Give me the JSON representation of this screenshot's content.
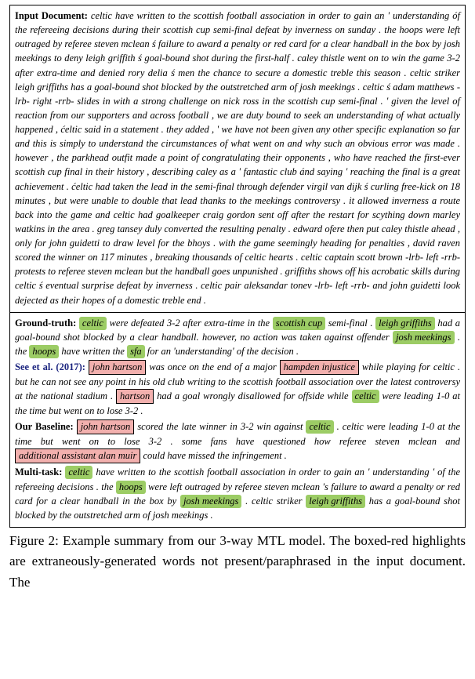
{
  "input": {
    "label": "Input Document:",
    "text": "celtic have written to the scottish football association in order to gain an ' understanding óf the refereeing decisions during their scottish cup semi-final defeat by inverness on sunday . the hoops were left outraged by referee steven mclean ś failure to award a penalty or red card for a clear handball in the box by josh meekings to deny leigh griffith ś goal-bound shot during the first-half . caley thistle went on to win the game 3-2 after extra-time and denied rory delia ś men the chance to secure a domestic treble this season . celtic striker leigh griffiths has a goal-bound shot blocked by the outstretched arm of josh meekings . celtic ś adam matthews -lrb- right -rrb- slides in with a strong challenge on nick ross in the scottish cup semi-final . ' given the level of reaction from our supporters and across football , we are duty bound to seek an understanding of what actually happened , ćeltic said in a statement .  they added , ' we have not been given any other specific explanation so far and this is simply to understand the circumstances of what went on and why such an obvious error was made . however , the parkhead outfit made a point of congratulating their opponents , who have reached the first-ever scottish cup final in their history , describing caley as a ' fantastic club ánd saying ' reaching the final is a great achievement . ćeltic had taken the lead in the semi-final through defender virgil van dijk ś curling free-kick on 18 minutes , but were unable to double that lead thanks to the meekings controversy .  it allowed inverness a route back into the game and celtic had goalkeeper craig gordon sent off after the restart for scything down marley watkins in the area . greg tansey duly converted the resulting penalty . edward ofere then put caley thistle ahead , only for john guidetti to draw level for the bhoys .  with the game seemingly heading for penalties , david raven scored the winner on 117 minutes , breaking thousands of celtic hearts . celtic captain scott brown -lrb- left -rrb- protests to referee steven mclean but the handball goes unpunished . griffiths shows off his acrobatic skills during celtic ś eventual surprise defeat by inverness . celtic pair aleksandar tonev -lrb- left -rrb- and john guidetti look dejected as their hopes of a domestic treble end ."
  },
  "ground_truth": {
    "label": "Ground-truth:",
    "hl": {
      "celtic": "celtic",
      "scottish_cup": "scottish cup",
      "leigh_griffiths": "leigh griffiths",
      "josh_meekings": "josh meekings",
      "hoops": "hoops",
      "sfa": "sfa"
    },
    "t1": " were defeated 3-2 after extra-time in the ",
    "t2": " semi-final . ",
    "t3": " had a goal-bound shot blocked by a clear handball.  however, no action was taken against offender ",
    "t4": " .  the ",
    "t5": " have written the ",
    "t6": " for an 'understanding' of the decision ."
  },
  "see": {
    "label": "See et al. (2017):",
    "hl": {
      "john_hartson": "john hartson",
      "hampden_injustice": "hampden injustice",
      "hartson": "hartson",
      "celtic": "celtic"
    },
    "t1": " was once on the end of a major ",
    "t2": " while playing for celtic . but he can not see any point in his old club writing to the scottish football association over the latest controversy at the national stadium . ",
    "t3": " had a goal wrongly disallowed for offside while ",
    "t4": " were leading 1-0 at the time but went on to lose 3-2 ."
  },
  "baseline": {
    "label": "Our Baseline:",
    "hl": {
      "john_hartson": "john hartson",
      "celtic": "celtic",
      "additional_assistant": "additional assistant alan muir"
    },
    "t1": " scored the late winner in 3-2 win against ",
    "t2": " . celtic were leading 1-0 at the time but went on to lose 3-2 . some fans have questioned how referee steven mclean and ",
    "t3": " could have missed the infringement ."
  },
  "multitask": {
    "label": "Multi-task:",
    "hl": {
      "celtic": "celtic",
      "hoops": "hoops",
      "josh_meekings": "josh meekings",
      "leigh_griffiths": "leigh griffiths"
    },
    "t1": " have written to the scottish football association in order to gain an ' understanding ' of the refereeing decisions . the ",
    "t2": " were left outraged by referee steven mclean 's failure to award a penalty or red card for a clear handball in the box by ",
    "t3": " .  celtic striker ",
    "t4": " has a goal-bound shot blocked by the outstretched arm of josh meekings ."
  },
  "caption": "Figure 2:  Example summary from our 3-way MTL model.  The boxed-red highlights are extraneously-generated words not present/paraphrased in the input document.  The"
}
